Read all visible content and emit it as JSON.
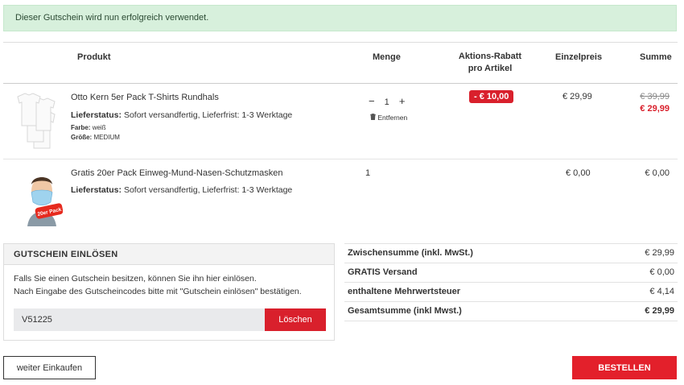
{
  "alert": {
    "message": "Dieser Gutschein wird nun erfolgreich verwendet."
  },
  "cart": {
    "headers": {
      "product": "Produkt",
      "quantity": "Menge",
      "discount_line1": "Aktions-Rabatt",
      "discount_line2": "pro Artikel",
      "unit_price": "Einzelpreis",
      "sum": "Summe"
    },
    "items": [
      {
        "name": "Otto Kern 5er Pack T-Shirts Rundhals",
        "delivery_label": "Lieferstatus:",
        "delivery_value": "Sofort versandfertig, Lieferfrist: 1-3 Werktage",
        "color_label": "Farbe:",
        "color_value": "weiß",
        "size_label": "Größe:",
        "size_value": "MEDIUM",
        "qty_minus": "−",
        "quantity": "1",
        "qty_plus": "+",
        "remove_label": "Entfernen",
        "discount": "- € 10,00",
        "unit_price": "€ 29,99",
        "sum_old": "€ 39,99",
        "sum_new": "€ 29,99"
      },
      {
        "name": "Gratis 20er Pack Einweg-Mund-Nasen-Schutzmasken",
        "delivery_label": "Lieferstatus:",
        "delivery_value": "Sofort versandfertig, Lieferfrist: 1-3 Werktage",
        "quantity": "1",
        "unit_price": "€ 0,00",
        "sum": "€ 0,00",
        "badge_text": "20er Pack"
      }
    ]
  },
  "coupon": {
    "title": "GUTSCHEIN EINLÖSEN",
    "text1": "Falls Sie einen Gutschein besitzen, können Sie ihn hier einlösen.",
    "text2": "Nach Eingabe des Gutscheincodes bitte mit \"Gutschein einlösen\" bestätigen.",
    "code": "V51225",
    "delete_button": "Löschen"
  },
  "summary": [
    {
      "label": "Zwischensumme (inkl. MwSt.)",
      "value": "€ 29,99"
    },
    {
      "label": "GRATIS Versand",
      "value": "€ 0,00"
    },
    {
      "label": "enthaltene Mehrwertsteuer",
      "value": "€ 4,14"
    },
    {
      "label": "Gesamtsumme (inkl Mwst.)",
      "value": "€ 29,99"
    }
  ],
  "actions": {
    "continue": "weiter Einkaufen",
    "order": "BESTELLEN"
  },
  "colors": {
    "accent": "#d9202c",
    "success_bg": "#d7f0dc"
  }
}
